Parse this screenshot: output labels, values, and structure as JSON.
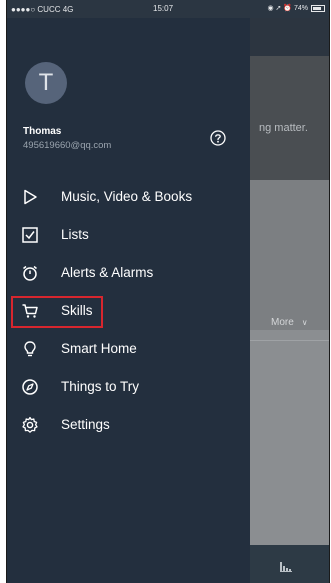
{
  "status_bar": {
    "carrier": "●●●●○ CUCC 4G",
    "time": "15:07",
    "right": "◉ ➚ ⏰ 74%"
  },
  "background": {
    "snippet_text": "ng matter.",
    "more_label": "More",
    "more_chevron": "∨"
  },
  "drawer": {
    "avatar_letter": "T",
    "user_name": "Thomas",
    "user_email": "495619660@qq.com",
    "menu": [
      {
        "label": "Music, Video & Books",
        "icon": "play-icon"
      },
      {
        "label": "Lists",
        "icon": "checkbox-icon"
      },
      {
        "label": "Alerts & Alarms",
        "icon": "stopwatch-icon"
      },
      {
        "label": "Skills",
        "icon": "cart-icon"
      },
      {
        "label": "Smart Home",
        "icon": "lightbulb-icon"
      },
      {
        "label": "Things to Try",
        "icon": "compass-icon"
      },
      {
        "label": "Settings",
        "icon": "gear-icon"
      }
    ]
  },
  "colors": {
    "drawer_bg": "#232f3e",
    "highlight_border": "#d7262e",
    "text": "#ffffff"
  }
}
